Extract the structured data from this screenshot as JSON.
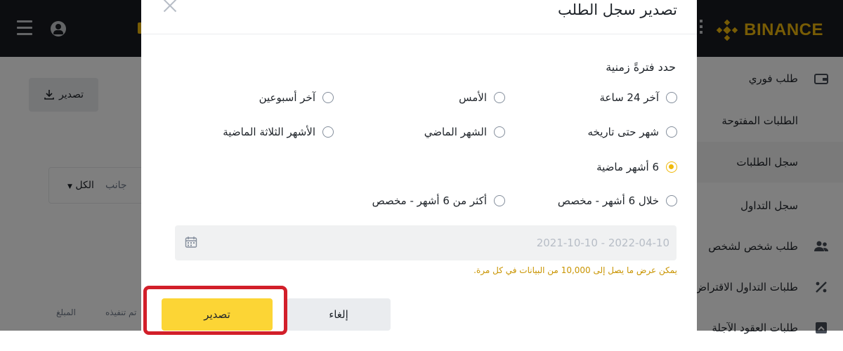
{
  "brand": {
    "name": "BINANCE",
    "color": "#F0B90B"
  },
  "header": {
    "menu_icon": "hamburger-icon",
    "user_icon": "user-icon"
  },
  "sidebar": {
    "items": [
      {
        "label": "طلب فوري",
        "icon": "wallet-icon"
      },
      {
        "label": "الطلبات المفتوحة",
        "icon": ""
      },
      {
        "label": "سجل الطلبات",
        "icon": "",
        "active": true
      },
      {
        "label": "سجل التداول",
        "icon": ""
      },
      {
        "label": "طلب شخص لشخص",
        "icon": "users-icon"
      },
      {
        "label": "طلبات التداول الاقتراض",
        "icon": "percent-icon"
      },
      {
        "label": "طلبات العقود الآجلة",
        "icon": "futures-icon"
      }
    ]
  },
  "main": {
    "export_label": "تصدير",
    "filter": {
      "all": "الكل",
      "side": "جانب"
    },
    "columns": [
      "المبلغ",
      "تم تنفيذه"
    ]
  },
  "modal": {
    "title": "تصدير سجل الطلب",
    "section_label": "حدد فترةً زمنية",
    "options": [
      {
        "label": "آخر 24 ساعة",
        "selected": false
      },
      {
        "label": "الأمس",
        "selected": false
      },
      {
        "label": "آخر أسبوعين",
        "selected": false
      },
      {
        "label": "شهر حتى تاريخه",
        "selected": false
      },
      {
        "label": "الشهر الماضي",
        "selected": false
      },
      {
        "label": "الأشهر الثلاثة الماضية",
        "selected": false
      },
      {
        "label": "6 أشهر ماضية",
        "selected": true
      },
      {
        "label": "خلال 6 أشهر - مخصص",
        "selected": false
      },
      {
        "label": "أكثر من 6 أشهر - مخصص",
        "selected": false
      }
    ],
    "date_range": "2021-10-10 - 2022-04-10",
    "note": "يمكن عرض ما يصل إلى 10,000 من البيانات في كل مرة.",
    "buttons": {
      "export": "تصدير",
      "cancel": "إلغاء"
    },
    "highlight_color": "#D21F2A"
  }
}
